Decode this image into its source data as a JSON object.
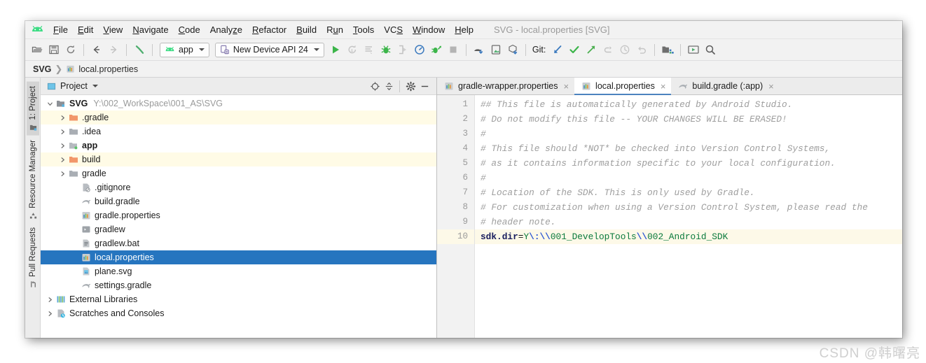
{
  "window": {
    "title": "SVG - local.properties [SVG]"
  },
  "menubar": {
    "items": [
      {
        "label": "File",
        "mnemonic": "F"
      },
      {
        "label": "Edit",
        "mnemonic": "E"
      },
      {
        "label": "View",
        "mnemonic": "V"
      },
      {
        "label": "Navigate",
        "mnemonic": "N"
      },
      {
        "label": "Code",
        "mnemonic": "C"
      },
      {
        "label": "Analyze",
        "mnemonic": "z"
      },
      {
        "label": "Refactor",
        "mnemonic": "R"
      },
      {
        "label": "Build",
        "mnemonic": "B"
      },
      {
        "label": "Run",
        "mnemonic": "u"
      },
      {
        "label": "Tools",
        "mnemonic": "T"
      },
      {
        "label": "VCS",
        "mnemonic": "S"
      },
      {
        "label": "Window",
        "mnemonic": "W"
      },
      {
        "label": "Help",
        "mnemonic": "H"
      }
    ]
  },
  "toolbar": {
    "open_label": "open-folder-icon",
    "save_label": "save-icon",
    "sync_label": "sync-icon",
    "back_label": "back-arrow-icon",
    "forward_label": "forward-arrow-icon",
    "build_label": "build-hammer-icon",
    "module_combo": "app",
    "device_combo": "New Device API 24",
    "git_label": "Git:",
    "run_label": "run-icon",
    "rerun_label": "rerun-icon",
    "apply_changes_label": "apply-changes-icon",
    "debug_label": "debug-icon",
    "attach_debugger_label": "attach-debugger-icon",
    "profiler_label": "profiler-icon",
    "run_coverage_label": "run-with-coverage-icon",
    "stop_label": "stop-icon",
    "sdk_manager_label": "sdk-manager-icon",
    "avd_manager_label": "avd-manager-icon",
    "sync_gradle_label": "sync-gradle-icon",
    "git_update_label": "git-update-icon",
    "git_commit_label": "git-commit-icon",
    "git_push_label": "git-push-icon",
    "git_rebase_label": "git-rebase-icon",
    "git_history_label": "git-history-icon",
    "git_revert_label": "git-revert-icon",
    "project_structure_label": "project-structure-icon",
    "device_file_explorer_label": "avd-device-icon",
    "search_label": "search-icon"
  },
  "navbar": {
    "root": "SVG",
    "separator": "❯",
    "file": "local.properties"
  },
  "rail": {
    "tabs": [
      {
        "label": "1: Project",
        "icon": "project-icon",
        "active": true
      },
      {
        "label": "Resource Manager",
        "icon": "resource-manager-icon",
        "active": false
      },
      {
        "label": "Pull Requests",
        "icon": "pull-requests-icon",
        "active": false
      }
    ]
  },
  "project_panel": {
    "title": "Project",
    "view_icon": "project-view-icon",
    "dropdown_icon": "chevron-down-icon",
    "target_icon": "scroll-from-source-icon",
    "collapse_icon": "collapse-all-icon",
    "settings_icon": "gear-icon",
    "hide_icon": "hide-panel-icon",
    "tree": [
      {
        "label": "SVG",
        "path": "Y:\\002_WorkSpace\\001_AS\\SVG",
        "indent": 0,
        "arrow": "down",
        "icon": "module-icon",
        "bold": true,
        "state": "normal"
      },
      {
        "label": ".gradle",
        "path": "",
        "indent": 1,
        "arrow": "right",
        "icon": "folder-excluded-icon",
        "bold": false,
        "state": "excluded"
      },
      {
        "label": ".idea",
        "path": "",
        "indent": 1,
        "arrow": "right",
        "icon": "folder-icon",
        "bold": false,
        "state": "normal"
      },
      {
        "label": "app",
        "path": "",
        "indent": 1,
        "arrow": "right",
        "icon": "module-app-icon",
        "bold": true,
        "state": "normal"
      },
      {
        "label": "build",
        "path": "",
        "indent": 1,
        "arrow": "right",
        "icon": "folder-excluded-icon",
        "bold": false,
        "state": "excluded"
      },
      {
        "label": "gradle",
        "path": "",
        "indent": 1,
        "arrow": "right",
        "icon": "folder-icon",
        "bold": false,
        "state": "normal"
      },
      {
        "label": ".gitignore",
        "path": "",
        "indent": 2,
        "arrow": "none",
        "icon": "gitignore-icon",
        "bold": false,
        "state": "normal"
      },
      {
        "label": "build.gradle",
        "path": "",
        "indent": 2,
        "arrow": "none",
        "icon": "gradle-icon",
        "bold": false,
        "state": "normal"
      },
      {
        "label": "gradle.properties",
        "path": "",
        "indent": 2,
        "arrow": "none",
        "icon": "properties-icon",
        "bold": false,
        "state": "normal"
      },
      {
        "label": "gradlew",
        "path": "",
        "indent": 2,
        "arrow": "none",
        "icon": "script-icon",
        "bold": false,
        "state": "normal"
      },
      {
        "label": "gradlew.bat",
        "path": "",
        "indent": 2,
        "arrow": "none",
        "icon": "bat-file-icon",
        "bold": false,
        "state": "normal"
      },
      {
        "label": "local.properties",
        "path": "",
        "indent": 2,
        "arrow": "none",
        "icon": "properties-icon",
        "bold": false,
        "state": "selected"
      },
      {
        "label": "plane.svg",
        "path": "",
        "indent": 2,
        "arrow": "none",
        "icon": "svg-file-icon",
        "bold": false,
        "state": "normal"
      },
      {
        "label": "settings.gradle",
        "path": "",
        "indent": 2,
        "arrow": "none",
        "icon": "gradle-icon",
        "bold": false,
        "state": "normal"
      },
      {
        "label": "External Libraries",
        "path": "",
        "indent": 0,
        "arrow": "right",
        "icon": "libraries-icon",
        "bold": false,
        "state": "normal"
      },
      {
        "label": "Scratches and Consoles",
        "path": "",
        "indent": 0,
        "arrow": "right",
        "icon": "scratches-icon",
        "bold": false,
        "state": "normal"
      }
    ]
  },
  "editor": {
    "tabs": [
      {
        "label": "gradle-wrapper.properties",
        "icon": "properties-icon",
        "active": false,
        "close": "×"
      },
      {
        "label": "local.properties",
        "icon": "properties-icon",
        "active": true,
        "close": "×"
      },
      {
        "label": "build.gradle (:app)",
        "icon": "gradle-icon",
        "active": false,
        "close": "×"
      }
    ],
    "line_numbers": [
      "1",
      "2",
      "3",
      "4",
      "5",
      "6",
      "7",
      "8",
      "9",
      "10"
    ],
    "current_line": 10,
    "lines": [
      {
        "n": 1,
        "type": "comment",
        "text": "## This file is automatically generated by Android Studio."
      },
      {
        "n": 2,
        "type": "comment",
        "text": "# Do not modify this file -- YOUR CHANGES WILL BE ERASED!"
      },
      {
        "n": 3,
        "type": "comment",
        "text": "#"
      },
      {
        "n": 4,
        "type": "comment",
        "text": "# This file should *NOT* be checked into Version Control Systems,"
      },
      {
        "n": 5,
        "type": "comment",
        "text": "# as it contains information specific to your local configuration."
      },
      {
        "n": 6,
        "type": "comment",
        "text": "#"
      },
      {
        "n": 7,
        "type": "comment",
        "text": "# Location of the SDK. This is only used by Gradle."
      },
      {
        "n": 8,
        "type": "comment",
        "text": "# For customization when using a Version Control System, please read the"
      },
      {
        "n": 9,
        "type": "comment",
        "text": "# header note."
      },
      {
        "n": 10,
        "type": "property",
        "key": "sdk.dir",
        "eq": "=",
        "value": "Y\\:\\\\001_DevelopTools\\\\002_Android_SDK"
      }
    ]
  },
  "watermark": "CSDN @韩曙亮",
  "colors": {
    "accent": "#2675bf",
    "tab_underline": "#4c83bf",
    "excluded_row": "#fffbe6",
    "caret_line": "#fdf9e8",
    "android_green": "#3ddc84",
    "comment": "#9e9e9e",
    "value_green": "#0a7a3c",
    "escape_blue": "#2b56d4"
  }
}
